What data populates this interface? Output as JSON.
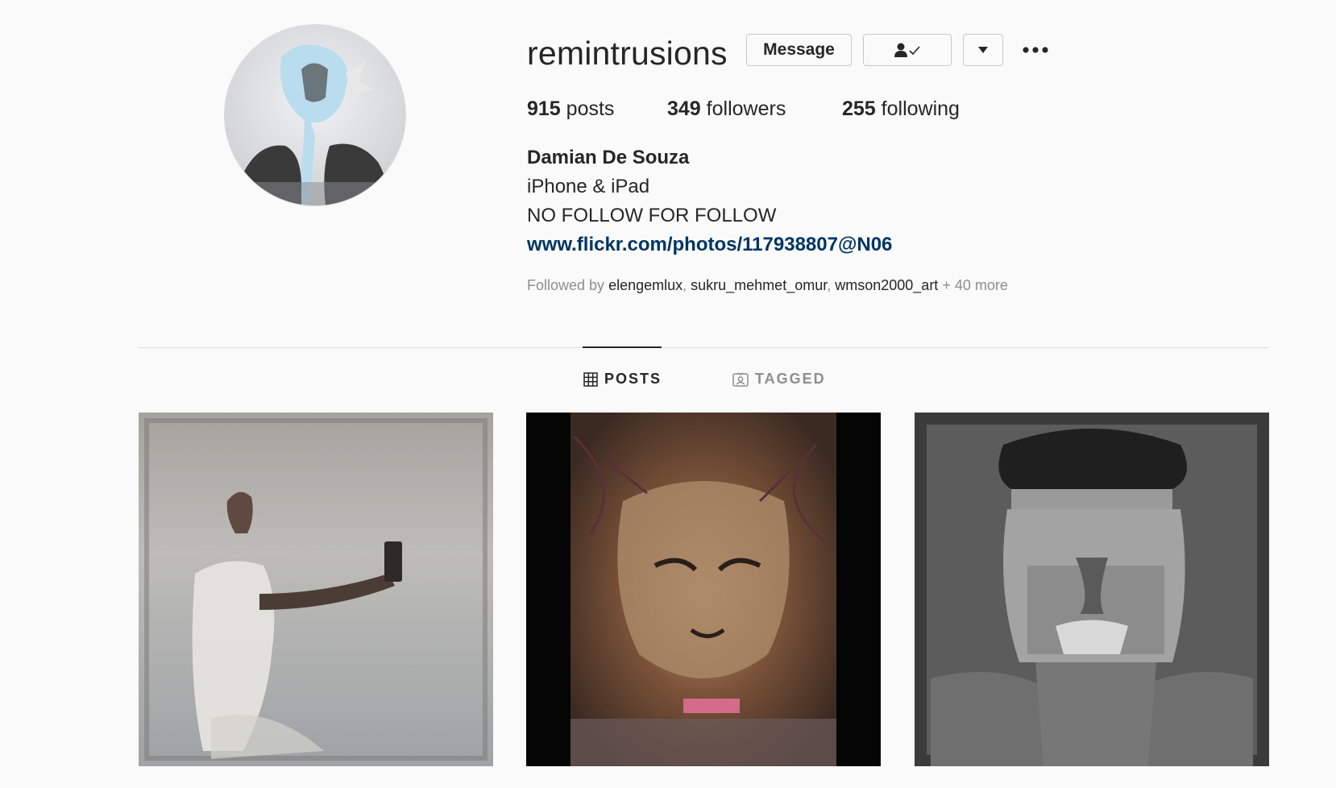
{
  "profile": {
    "username": "remintrusions",
    "full_name": "Damian De Souza",
    "bio_lines": [
      "iPhone & iPad",
      "NO FOLLOW FOR FOLLOW"
    ],
    "link": "www.flickr.com/photos/117938807@N06",
    "avatar_icon": "profile-photo"
  },
  "actions": {
    "message_label": "Message",
    "following_icon": "person-check-icon",
    "dropdown_icon": "chevron-down-icon",
    "more_icon": "more-options-icon"
  },
  "stats": {
    "posts_count": "915",
    "posts_label": "posts",
    "followers_count": "349",
    "followers_label": "followers",
    "following_count": "255",
    "following_label": "following"
  },
  "followed_by": {
    "prefix": "Followed by",
    "users": [
      "elengemlux",
      "sukru_mehmet_omur",
      "wmson2000_art"
    ],
    "more": "+ 40 more"
  },
  "tabs": [
    {
      "label": "POSTS",
      "icon": "grid-icon",
      "active": true
    },
    {
      "label": "TAGGED",
      "icon": "tagged-icon",
      "active": false
    }
  ],
  "colors": {
    "background": "#fafafa",
    "text": "#262626",
    "muted": "#8e8e8e",
    "link": "#003569",
    "border": "#dbdbdb"
  }
}
